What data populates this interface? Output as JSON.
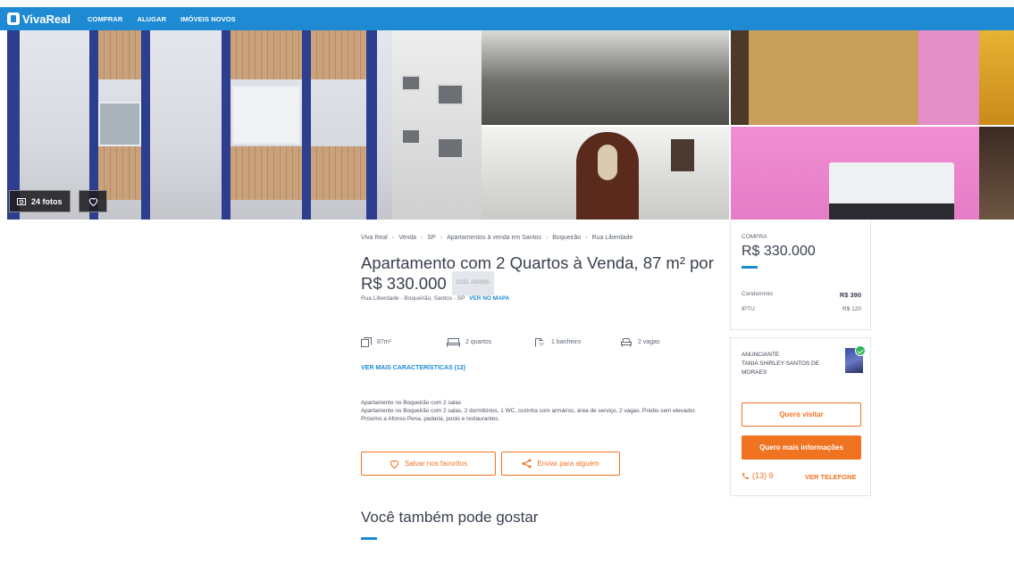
{
  "header": {
    "logo": "VivaReal",
    "nav": [
      "COMPRAR",
      "ALUGAR",
      "IMÓVEIS NOVOS"
    ]
  },
  "gallery": {
    "photo_count": "24 fotos"
  },
  "breadcrumb": [
    "Viva Real",
    "Venda",
    "SP",
    "Apartamentos à venda em Santos",
    "Boqueirão",
    "Rua Liberdade"
  ],
  "listing": {
    "title": "Apartamento com 2 Quartos à Venda, 87 m² por R$ 330.000",
    "code": "COD. A80085",
    "address": "Rua Liberdade - Boqueirão, Santos - SP",
    "map_link": "VER NO MAPA"
  },
  "amenities": [
    {
      "icon": "area-icon",
      "label": "87m²"
    },
    {
      "icon": "bed-icon",
      "label": "2 quartos"
    },
    {
      "icon": "shower-icon",
      "label": "1 banheiro"
    },
    {
      "icon": "car-icon",
      "label": "2 vagas"
    }
  ],
  "see_more": "VER MAIS CARACTERÍSTICAS (12)",
  "description": {
    "heading": "Apartamento no Boqueirão com 2 salas",
    "body": "Apartamento no Boqueirão com 2 salas, 2 dormitórios, 1 WC, cozinha com armários, área de serviço, 2 vagas. Prédio sem elevador. Próximo a Afonso Pena, padaria, posto e restaurantes."
  },
  "actions": {
    "save": "Salvar nos favoritos",
    "send": "Enviar para alguém"
  },
  "also_like": "Você também pode gostar",
  "price_card": {
    "label": "COMPRA",
    "price": "R$ 330.000",
    "condo_label": "Condomínio",
    "condo_value": "R$ 390",
    "iptu_label": "IPTU",
    "iptu_value": "R$ 120"
  },
  "advertiser": {
    "label": "ANUNCIANTE",
    "name": "TANIA SHIRLEY SANTOS DE MORAES",
    "visit": "Quero visitar",
    "info": "Quero mais informações",
    "phone_visible": "(13) 9",
    "phone_link": "VER TELEFONE"
  },
  "colors": {
    "brand_blue": "#1e8ad3",
    "accent_orange": "#f07321"
  }
}
